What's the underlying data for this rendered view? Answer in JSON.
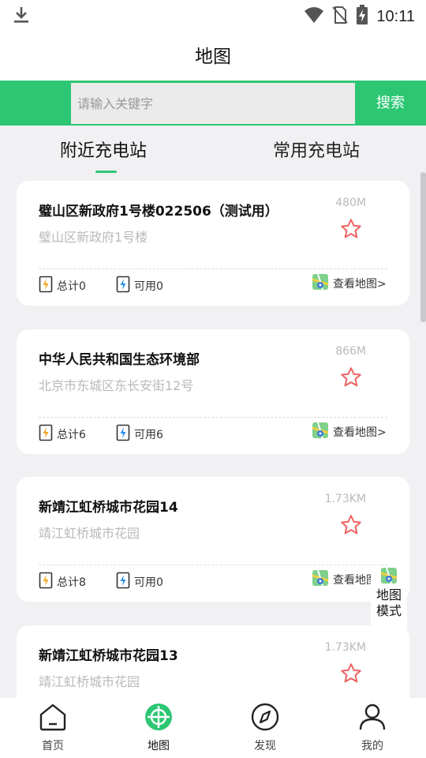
{
  "status_bar": {
    "time": "10:11"
  },
  "header": {
    "title": "地图"
  },
  "search": {
    "placeholder": "请输入关键字",
    "button_label": "搜索"
  },
  "tabs": [
    {
      "label": "附近充电站",
      "active": true
    },
    {
      "label": "常用充电站",
      "active": false
    }
  ],
  "stations": [
    {
      "name": "璧山区新政府1号楼022506（测试用）",
      "address": "璧山区新政府1号楼",
      "distance": "480M",
      "total": "总计0",
      "available": "可用0",
      "map_link": "查看地图>"
    },
    {
      "name": "中华人民共和国生态环境部",
      "address": "北京市东城区东长安街12号",
      "distance": "866M",
      "total": "总计6",
      "available": "可用6",
      "map_link": "查看地图>"
    },
    {
      "name": "新靖江虹桥城市花园14",
      "address": "靖江虹桥城市花园",
      "distance": "1.73KM",
      "total": "总计8",
      "available": "可用0",
      "map_link": "查看地图"
    },
    {
      "name": "新靖江虹桥城市花园13",
      "address": "靖江虹桥城市花园",
      "distance": "1.73KM"
    }
  ],
  "map_mode": {
    "line1": "地图",
    "line2": "模式"
  },
  "nav": [
    {
      "label": "首页"
    },
    {
      "label": "地图"
    },
    {
      "label": "发现"
    },
    {
      "label": "我的"
    }
  ],
  "colors": {
    "accent": "#2dc774",
    "star": "#f06262",
    "bolt_orange": "#f5a623",
    "bolt_blue": "#2b8fe8"
  }
}
